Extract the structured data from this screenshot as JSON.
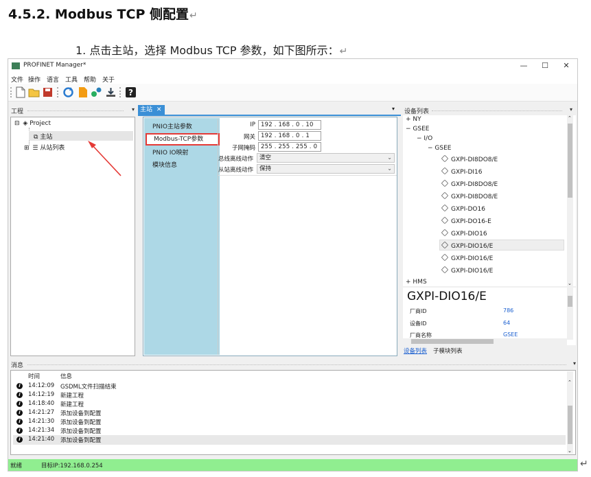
{
  "doc": {
    "heading": "4.5.2.  Modbus TCP 侧配置",
    "step": "1. 点击主站，选择 Modbus TCP 参数，如下图所示：",
    "return_mark": "↵"
  },
  "window": {
    "title": "PROFINET Manager*",
    "controls": {
      "minimize": "—",
      "maximize": "☐",
      "close": "✕"
    }
  },
  "menu": [
    "文件",
    "操作",
    "语言",
    "工具",
    "帮助",
    "关于"
  ],
  "project_panel": {
    "title": "工程",
    "root": "Project",
    "master": "主站",
    "slaves": "从站列表",
    "expand_root": "⊟",
    "expand_slaves": "⊞"
  },
  "master_tab": {
    "label": "主站",
    "close": "✕"
  },
  "config_tabs": [
    "PNIO主站参数",
    "Modbus-TCP参数",
    "PNIO IO映射",
    "模块信息"
  ],
  "modbus_fields": {
    "ip_label": "IP",
    "ip_value": "192 . 168 .  0  .  10",
    "gateway_label": "网关",
    "gateway_value": "192 . 168 .  0  .  1",
    "mask_label": "子网掩码",
    "mask_value": "255 . 255 . 255 .  0",
    "bus_off_label": "总线离线动作",
    "bus_off_value": "清空",
    "slave_off_label": "从站离线动作",
    "slave_off_value": "保持"
  },
  "device_panel": {
    "title": "设备列表",
    "groups": [
      "NY",
      "GSEE",
      "I/O",
      "GSEE",
      "HMS"
    ],
    "devices": [
      "GXPI-DI8DO8/E",
      "GXPI-DI16",
      "GXPI-DI8DO8/E",
      "GXPI-DI8DO8/E",
      "GXPI-DO16",
      "GXPI-DO16-E",
      "GXPI-DIO16",
      "GXPI-DIO16/E",
      "GXPI-DIO16/E",
      "GXPI-DIO16/E"
    ],
    "detail_name": "GXPI-DIO16/E",
    "vendor_id_label": "厂商ID",
    "vendor_id": "786",
    "device_id_label": "设备ID",
    "device_id": "64",
    "vendor_name_label": "厂商名称",
    "vendor_name": "GSEE",
    "tabs": [
      "设备列表",
      "子模块列表"
    ]
  },
  "messages": {
    "title": "消息",
    "col_time": "时间",
    "col_info": "信息",
    "rows": [
      {
        "time": "14:12:09",
        "text": "GSDML文件扫描结束"
      },
      {
        "time": "14:12:19",
        "text": "新建工程"
      },
      {
        "time": "14:18:40",
        "text": "新建工程"
      },
      {
        "time": "14:21:27",
        "text": "添加设备到配置"
      },
      {
        "time": "14:21:30",
        "text": "添加设备到配置"
      },
      {
        "time": "14:21:34",
        "text": "添加设备到配置"
      },
      {
        "time": "14:21:40",
        "text": "添加设备到配置"
      }
    ]
  },
  "status": {
    "ready": "就绪",
    "target_ip": "目标IP:192.168.0.254"
  },
  "colors": {
    "tab_blue": "#add8e6",
    "status_green": "#90ee90",
    "highlight_red": "#e53935",
    "link_blue": "#1a5fd0"
  },
  "icons": [
    "app-icon",
    "new-file-icon",
    "open-folder-icon",
    "save-icon",
    "refresh-icon",
    "export-icon",
    "connect-icon",
    "download-icon",
    "help-icon"
  ]
}
